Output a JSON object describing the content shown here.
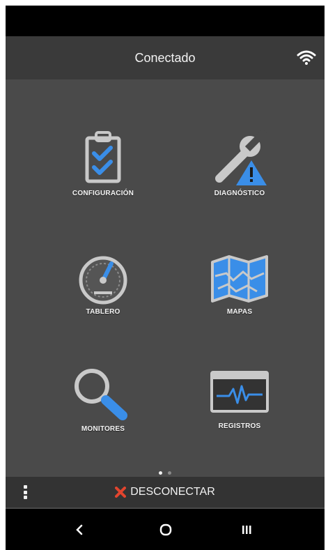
{
  "header": {
    "title": "Conectado",
    "wifi_icon": "wifi-icon"
  },
  "tiles": [
    {
      "label": "CONFIGURACIÓN",
      "icon": "clipboard-check-icon"
    },
    {
      "label": "DIAGNÓSTICO",
      "icon": "wrench-warning-icon"
    },
    {
      "label": "TABLERO",
      "icon": "gauge-icon"
    },
    {
      "label": "MAPAS",
      "icon": "map-icon"
    },
    {
      "label": "MONITORES",
      "icon": "magnifier-icon"
    },
    {
      "label": "REGISTROS",
      "icon": "waveform-monitor-icon"
    }
  ],
  "pager": {
    "pages": 2,
    "active": 1
  },
  "bottom": {
    "disconnect_label": "DESCONECTAR",
    "menu_icon": "kebab-menu-icon",
    "close_icon": "x-icon"
  },
  "navbar": {
    "back_label": "<",
    "home_icon": "home-icon",
    "recents_icon": "recents-icon"
  },
  "colors": {
    "accent": "#3a8ee8",
    "warning": "#3a8ee8",
    "close": "#e2452e",
    "background": "#4a4a4a",
    "header": "#3a3a3a"
  }
}
